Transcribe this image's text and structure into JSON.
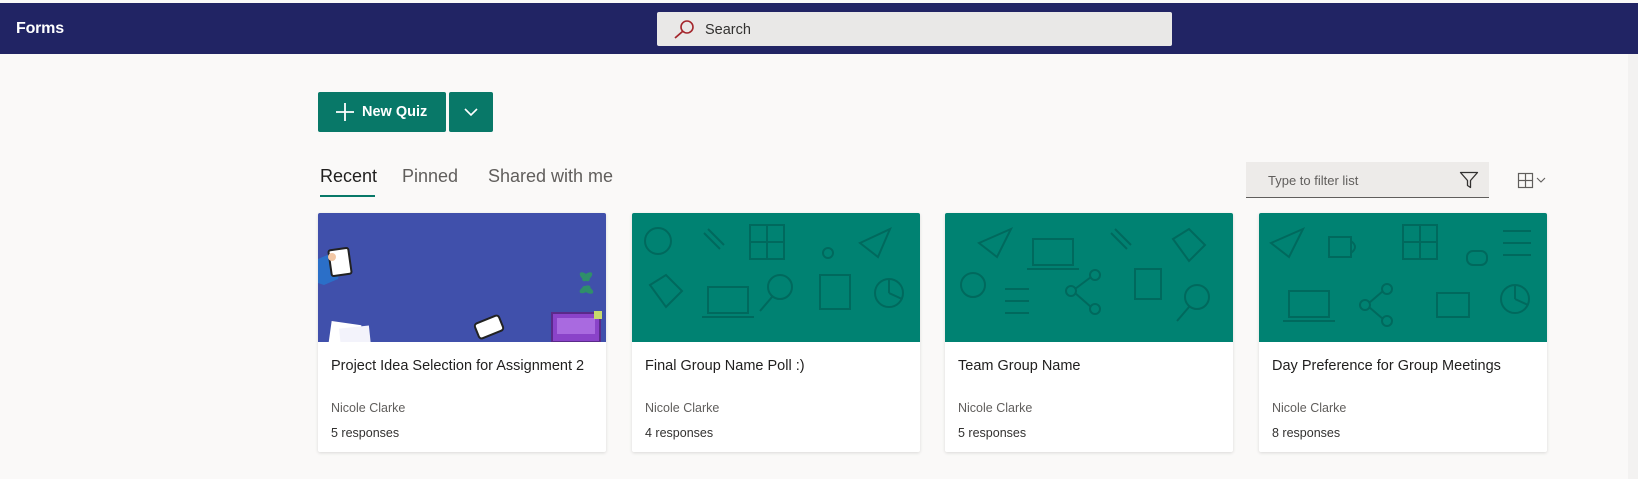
{
  "app": {
    "title": "Forms"
  },
  "search": {
    "label": "Search"
  },
  "toolbar": {
    "new_quiz_label": "New Quiz"
  },
  "tabs": [
    {
      "label": "Recent",
      "active": true
    },
    {
      "label": "Pinned",
      "active": false
    },
    {
      "label": "Shared with me",
      "active": false
    }
  ],
  "filter": {
    "placeholder": "Type to filter list"
  },
  "colors": {
    "header": "#212464",
    "accent": "#087868",
    "thumb_blue": "#4050ab",
    "thumb_teal": "#008272"
  },
  "cards": [
    {
      "title": "Project Idea Selection for Assignment 2",
      "owner": "Nicole Clarke",
      "responses": "5 responses",
      "thumbnail": "blue-desk-illustration"
    },
    {
      "title": "Final Group Name Poll :)",
      "owner": "Nicole Clarke",
      "responses": "4 responses",
      "thumbnail": "teal-icon-pattern"
    },
    {
      "title": "Team Group Name",
      "owner": "Nicole Clarke",
      "responses": "5 responses",
      "thumbnail": "teal-icon-pattern"
    },
    {
      "title": "Day Preference for Group Meetings",
      "owner": "Nicole Clarke",
      "responses": "8 responses",
      "thumbnail": "teal-icon-pattern"
    }
  ]
}
